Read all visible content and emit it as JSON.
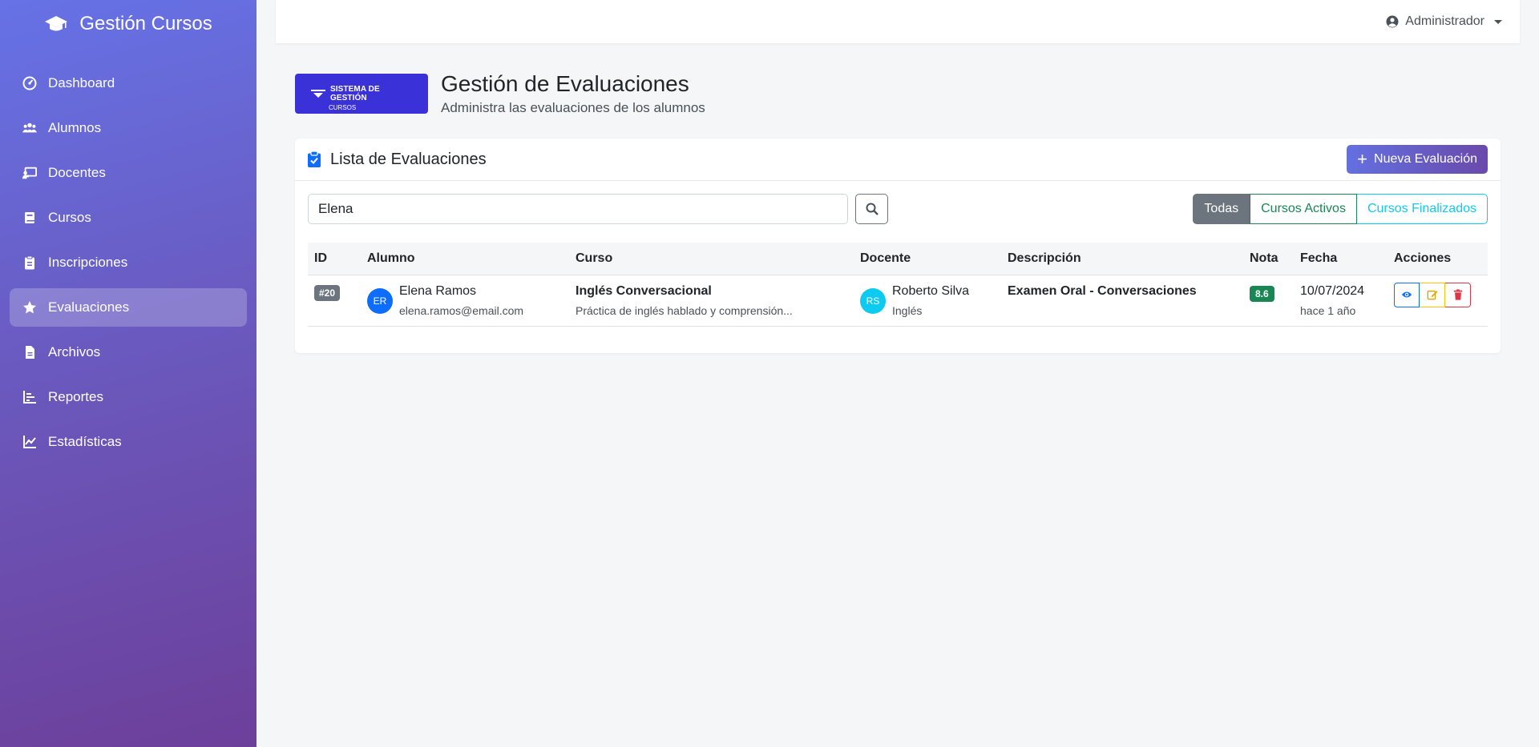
{
  "app": {
    "title": "Gestión Cursos",
    "logo_icon": "graduation-cap-icon"
  },
  "sidebar": {
    "items": [
      {
        "label": "Dashboard",
        "icon": "speedometer-icon",
        "active": false
      },
      {
        "label": "Alumnos",
        "icon": "users-icon",
        "active": false
      },
      {
        "label": "Docentes",
        "icon": "chalkboard-teacher-icon",
        "active": false
      },
      {
        "label": "Cursos",
        "icon": "book-icon",
        "active": false
      },
      {
        "label": "Inscripciones",
        "icon": "clipboard-list-icon",
        "active": false
      },
      {
        "label": "Evaluaciones",
        "icon": "star-icon",
        "active": true
      },
      {
        "label": "Archivos",
        "icon": "file-icon",
        "active": false
      },
      {
        "label": "Reportes",
        "icon": "bar-list-icon",
        "active": false
      },
      {
        "label": "Estadísticas",
        "icon": "line-chart-icon",
        "active": false
      }
    ]
  },
  "topbar": {
    "user": "Administrador",
    "user_icon": "user-circle-icon"
  },
  "header": {
    "logo_text_line1": "SISTEMA DE",
    "logo_text_line2": "GESTIÓN",
    "logo_text_line3": "CURSOS",
    "title": "Gestión de Evaluaciones",
    "subtitle": "Administra las evaluaciones de los alumnos"
  },
  "card": {
    "title": "Lista de Evaluaciones",
    "new_button": "Nueva Evaluación",
    "search": {
      "value": "Elena",
      "placeholder": ""
    },
    "filters": [
      "Todas",
      "Cursos Activos",
      "Cursos Finalizados"
    ],
    "active_filter": "Todas"
  },
  "table": {
    "columns": [
      "ID",
      "Alumno",
      "Curso",
      "Docente",
      "Descripción",
      "Nota",
      "Fecha",
      "Acciones"
    ],
    "rows": [
      {
        "id": "#20",
        "alumno_initials": "ER",
        "alumno_name": "Elena Ramos",
        "alumno_email": "elena.ramos@email.com",
        "curso_name": "Inglés Conversacional",
        "curso_desc": "Práctica de inglés hablado y comprensión...",
        "docente_initials": "RS",
        "docente_name": "Roberto Silva",
        "docente_subject": "Inglés",
        "descripcion": "Examen Oral - Conversaciones",
        "nota": "8.6",
        "fecha": "10/07/2024",
        "fecha_rel": "hace 1 año"
      }
    ]
  },
  "colors": {
    "accent": "#6470e0",
    "success": "#198754",
    "info": "#0dcaf0",
    "danger": "#dc3545",
    "warning": "#ffc107"
  }
}
